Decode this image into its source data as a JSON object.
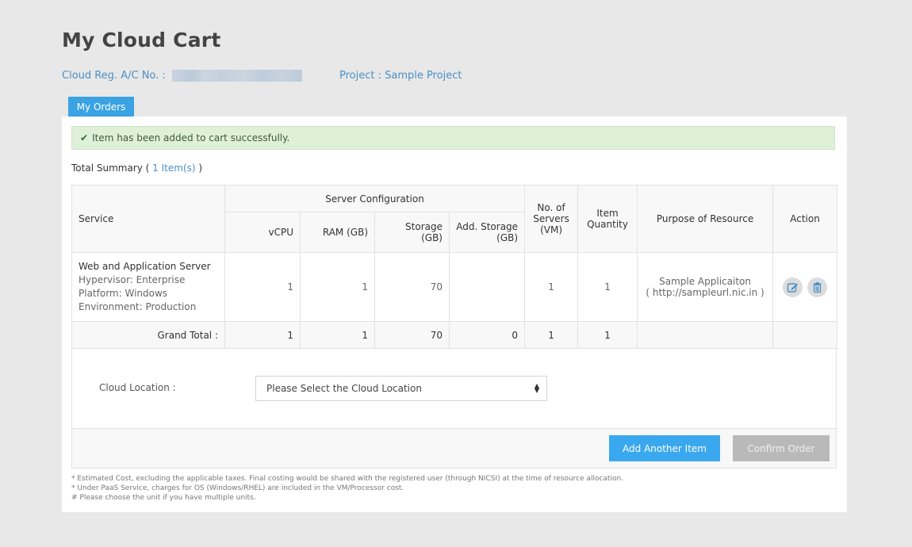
{
  "page": {
    "title": "My Cloud Cart",
    "reg_label": "Cloud Reg. A/C No. :",
    "project_label": "Project : Sample Project"
  },
  "tabs": [
    {
      "label": "My Orders",
      "active": true
    }
  ],
  "alert": {
    "icon": "check-icon",
    "message": "Item has been added to cart successfully."
  },
  "summary": {
    "label": "Total Summary (",
    "count": "1 Item(s)",
    "close": ")"
  },
  "table": {
    "headers": {
      "service": "Service",
      "server_config": "Server Configuration",
      "vcpu": "vCPU",
      "ram": "RAM (GB)",
      "storage": "Storage (GB)",
      "add_storage": "Add. Storage (GB)",
      "servers": "No. of Servers (VM)",
      "quantity": "Item Quantity",
      "purpose": "Purpose of Resource",
      "action": "Action"
    },
    "items": [
      {
        "service_name": "Web and Application Server",
        "hypervisor": "Hypervisor: Enterprise",
        "platform": "Platform: Windows",
        "environment": "Environment: Production",
        "vcpu": "1",
        "ram": "1",
        "storage": "70",
        "add_storage": "",
        "servers": "1",
        "quantity": "1",
        "purpose_name": "Sample Applicaiton",
        "purpose_url": "( http://sampleurl.nic.in )",
        "actions": [
          "edit-icon",
          "trash-icon"
        ]
      }
    ],
    "grand_total": {
      "label": "Grand Total :",
      "vcpu": "1",
      "ram": "1",
      "storage": "70",
      "add_storage": "0",
      "servers": "1",
      "quantity": "1"
    }
  },
  "location": {
    "label": "Cloud Location :",
    "selected": "Please Select the Cloud Location"
  },
  "buttons": {
    "add_another": "Add Another Item",
    "confirm": "Confirm Order"
  },
  "footnotes": [
    "* Estimated Cost, excluding the applicable taxes. Final costing would be shared with the registered user (through NICSI) at the time of resource allocation.",
    "* Under PaaS Service, charges for OS (Windows/RHEL) are included in the VM/Processor cost.",
    "# Please choose the unit if you have multiple units."
  ],
  "colors": {
    "accent": "#3aa3e3",
    "link": "#4a90c8",
    "success_bg": "#dff0d8",
    "disabled": "#b9b9b9"
  }
}
